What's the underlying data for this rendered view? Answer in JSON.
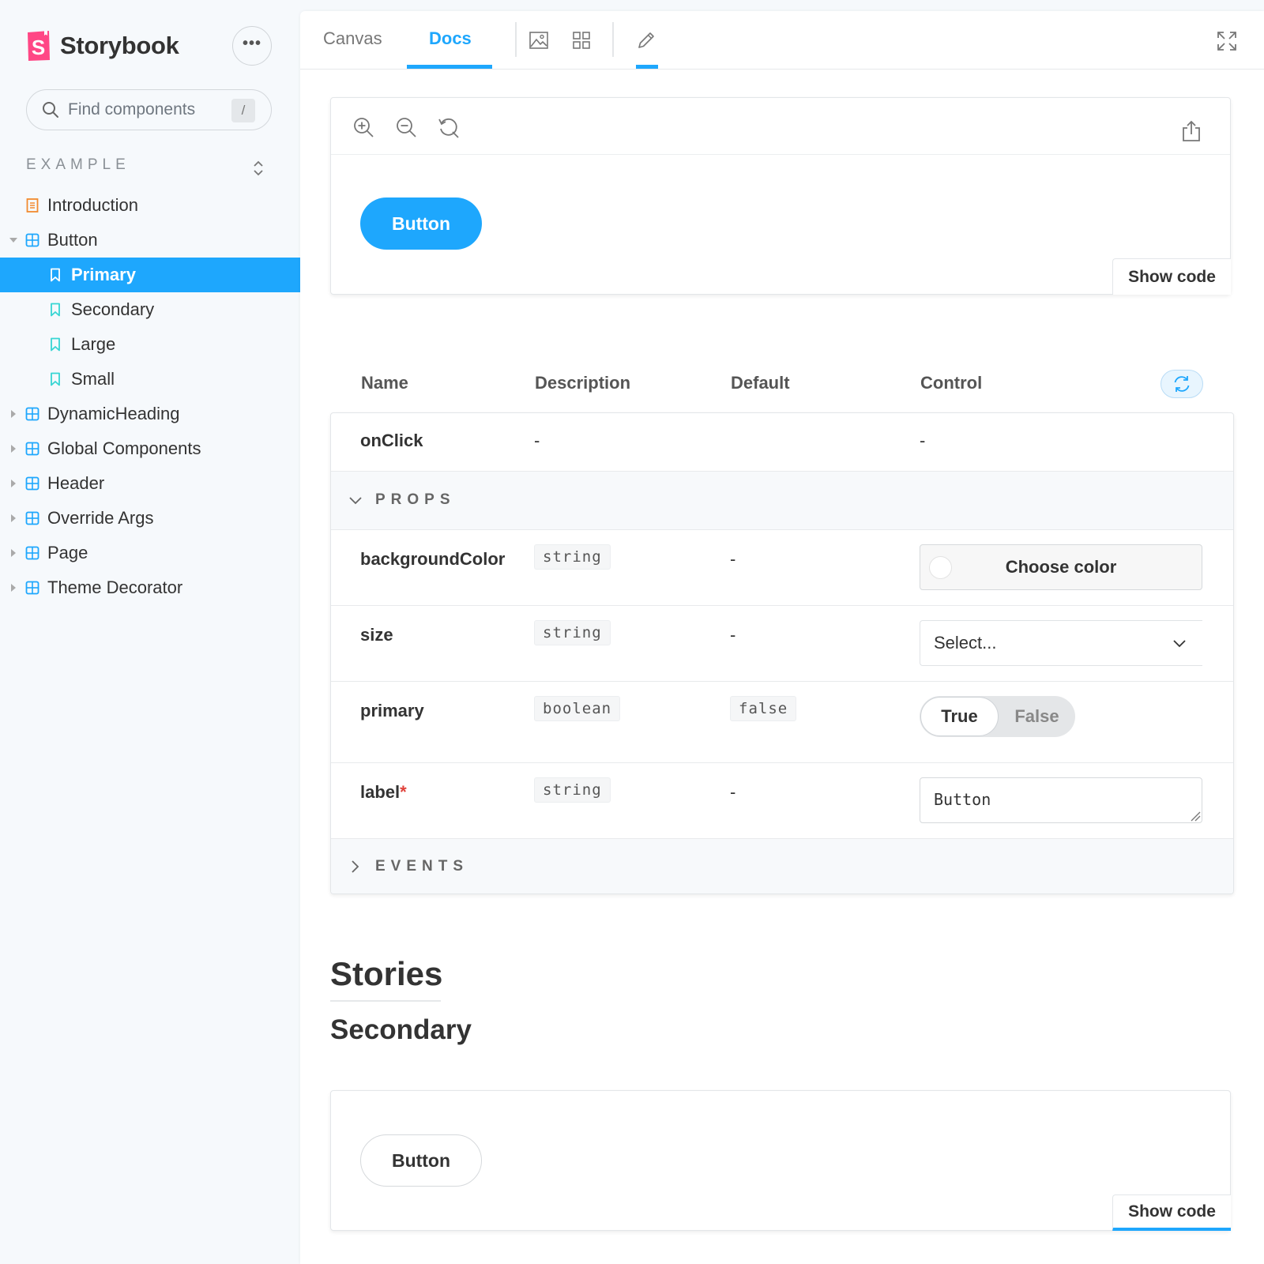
{
  "brand": {
    "name": "Storybook",
    "menu_glyph": "•••",
    "logo_color": "#ff4785",
    "accent": "#1ea7fd"
  },
  "search": {
    "placeholder": "Find components",
    "shortcut": "/"
  },
  "sidebar": {
    "section": "EXAMPLE",
    "items": [
      {
        "label": "Introduction",
        "icon": "document-icon",
        "level": 0
      },
      {
        "label": "Button",
        "icon": "component-icon",
        "level": 0,
        "expanded": true
      },
      {
        "label": "Primary",
        "icon": "bookmark-icon",
        "level": 1,
        "selected": true
      },
      {
        "label": "Secondary",
        "icon": "bookmark-icon",
        "level": 1
      },
      {
        "label": "Large",
        "icon": "bookmark-icon",
        "level": 1
      },
      {
        "label": "Small",
        "icon": "bookmark-icon",
        "level": 1
      },
      {
        "label": "DynamicHeading",
        "icon": "component-icon",
        "level": 0
      },
      {
        "label": "Global Components",
        "icon": "component-icon",
        "level": 0
      },
      {
        "label": "Header",
        "icon": "component-icon",
        "level": 0
      },
      {
        "label": "Override Args",
        "icon": "component-icon",
        "level": 0
      },
      {
        "label": "Page",
        "icon": "component-icon",
        "level": 0
      },
      {
        "label": "Theme Decorator",
        "icon": "component-icon",
        "level": 0
      }
    ]
  },
  "toolbar": {
    "tabs": [
      {
        "label": "Canvas",
        "active": false
      },
      {
        "label": "Docs",
        "active": true
      }
    ],
    "icons": [
      "image-icon",
      "grid-icon",
      "pencil-icon",
      "fullscreen-icon"
    ]
  },
  "primary_preview": {
    "tools": [
      "zoom-in-icon",
      "zoom-out-icon",
      "zoom-reset-icon",
      "share-icon"
    ],
    "button_label": "Button",
    "show_code": "Show code"
  },
  "args_table": {
    "headers": {
      "name": "Name",
      "description": "Description",
      "default": "Default",
      "control": "Control"
    },
    "onclick": {
      "name": "onClick",
      "description": "-",
      "control": "-"
    },
    "props_group": "PROPS",
    "events_group": "EVENTS",
    "rows": {
      "backgroundColor": {
        "name": "backgroundColor",
        "type": "string",
        "default": "-",
        "control": "Choose color"
      },
      "size": {
        "name": "size",
        "type": "string",
        "default": "-",
        "control": "Select..."
      },
      "primary": {
        "name": "primary",
        "type": "boolean",
        "default": "false",
        "control_true": "True",
        "control_false": "False",
        "value": true
      },
      "label": {
        "name": "label",
        "required_mark": "*",
        "type": "string",
        "default": "-",
        "value": "Button"
      }
    }
  },
  "stories": {
    "heading": "Stories",
    "subheading": "Secondary",
    "button_label": "Button",
    "show_code": "Show code"
  }
}
